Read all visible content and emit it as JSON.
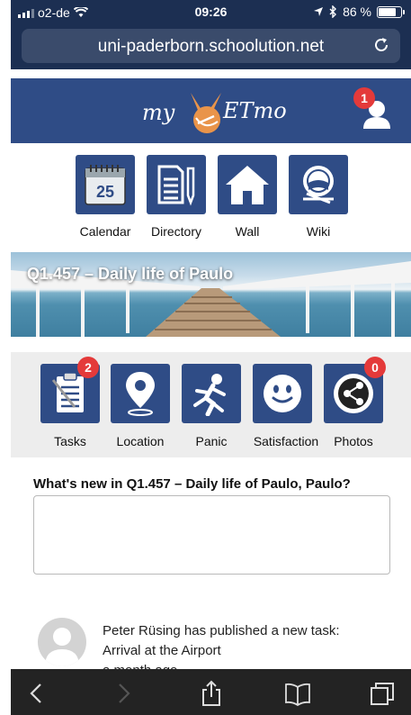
{
  "status": {
    "carrier": "o2-de",
    "time": "09:26",
    "battery": "86 %",
    "battery_level": 0.86
  },
  "browser": {
    "url": "uni-paderborn.schoolution.net"
  },
  "header": {
    "logo_prefix": "my",
    "logo_suffix": "ETmo",
    "notification_count": "1"
  },
  "top_menu": [
    {
      "label": "Calendar",
      "icon": "calendar-icon",
      "calendar_day": "25"
    },
    {
      "label": "Directory",
      "icon": "directory-icon"
    },
    {
      "label": "Wall",
      "icon": "house-icon"
    },
    {
      "label": "Wiki",
      "icon": "wiki-icon"
    }
  ],
  "banner": {
    "title": "Q1.457 – Daily life of Paulo"
  },
  "tools": [
    {
      "label": "Tasks",
      "icon": "clipboard-icon",
      "badge": "2"
    },
    {
      "label": "Location",
      "icon": "location-pin-icon"
    },
    {
      "label": "Panic",
      "icon": "running-figure-icon"
    },
    {
      "label": "Satisfaction",
      "icon": "smiley-icon"
    },
    {
      "label": "Photos",
      "icon": "share-icon",
      "badge": "0"
    }
  ],
  "post": {
    "prompt": "What's new in Q1.457 – Daily life of Paulo, Paulo?",
    "value": ""
  },
  "feed": [
    {
      "line1": "Peter Rüsing has published a new task:",
      "line2": "Arrival at the Airport",
      "line3": "a month ago"
    }
  ],
  "colors": {
    "brand": "#2f4c86",
    "badge": "#e43a3a",
    "topbar": "#1c2f52"
  }
}
